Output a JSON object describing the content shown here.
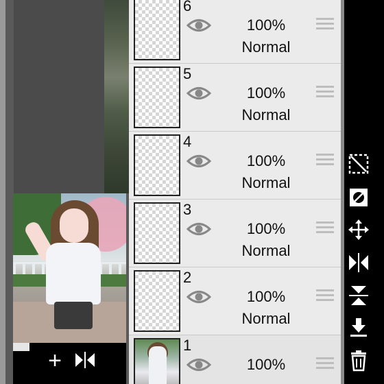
{
  "layers": [
    {
      "number": "6",
      "opacity": "100%",
      "blend": "Normal"
    },
    {
      "number": "5",
      "opacity": "100%",
      "blend": "Normal"
    },
    {
      "number": "4",
      "opacity": "100%",
      "blend": "Normal"
    },
    {
      "number": "3",
      "opacity": "100%",
      "blend": "Normal"
    },
    {
      "number": "2",
      "opacity": "100%",
      "blend": "Normal"
    },
    {
      "number": "1",
      "opacity": "100%",
      "blend": ""
    }
  ],
  "icons": {
    "add": "plus-icon",
    "flip": "flip-horizontal-icon",
    "visibility": "eye-icon",
    "reorder": "drag-handle-icon",
    "clear_selection": "clear-selection-icon",
    "lock_transparency": "lock-transparency-icon",
    "move": "move-icon",
    "flip_h": "flip-horizontal-icon",
    "flip_v": "flip-vertical-icon",
    "merge_down": "merge-down-icon",
    "delete": "trash-icon"
  },
  "colors": {
    "panel_bg": "#ebebeb",
    "toolbar_bg": "#000000",
    "icon_fg": "#ffffff"
  }
}
